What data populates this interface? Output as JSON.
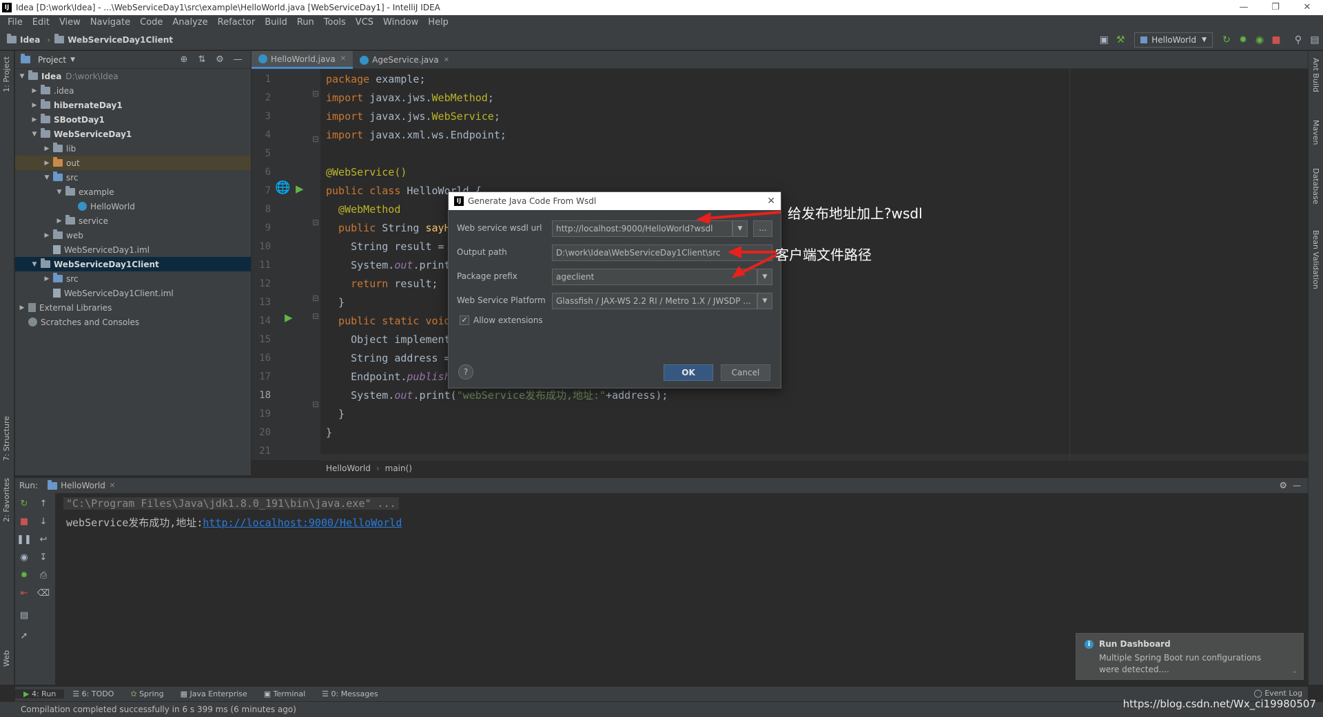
{
  "window": {
    "title": "Idea [D:\\work\\Idea] - ...\\WebServiceDay1\\src\\example\\HelloWorld.java [WebServiceDay1] - IntelliJ IDEA",
    "app_icon": "IJ"
  },
  "menu": [
    "File",
    "Edit",
    "View",
    "Navigate",
    "Code",
    "Analyze",
    "Refactor",
    "Build",
    "Run",
    "Tools",
    "VCS",
    "Window",
    "Help"
  ],
  "navbar": {
    "crumbs": [
      "Idea",
      "WebServiceDay1Client"
    ],
    "run_config": "HelloWorld"
  },
  "left_strip": {
    "project": "1: Project",
    "structure": "7: Structure",
    "favorites": "2: Favorites",
    "web": "Web"
  },
  "right_strip": {
    "ant": "Ant Build",
    "maven": "Maven",
    "database": "Database",
    "bean": "Bean Validation"
  },
  "project": {
    "title": "Project",
    "tree": [
      {
        "label": "Idea",
        "extra": "D:\\work\\Idea",
        "depth": 0,
        "arrow": "down",
        "icon": "folder",
        "bold": true
      },
      {
        "label": ".idea",
        "depth": 1,
        "arrow": "right",
        "icon": "folder"
      },
      {
        "label": "hibernateDay1",
        "depth": 1,
        "arrow": "right",
        "icon": "folder",
        "bold": true
      },
      {
        "label": "SBootDay1",
        "depth": 1,
        "arrow": "right",
        "icon": "folder",
        "bold": true
      },
      {
        "label": "WebServiceDay1",
        "depth": 1,
        "arrow": "down",
        "icon": "folder",
        "bold": true
      },
      {
        "label": "lib",
        "depth": 2,
        "arrow": "right",
        "icon": "folder"
      },
      {
        "label": "out",
        "depth": 2,
        "arrow": "right",
        "icon": "folder-orange",
        "state": "excluded"
      },
      {
        "label": "src",
        "depth": 2,
        "arrow": "down",
        "icon": "folder-blue"
      },
      {
        "label": "example",
        "depth": 3,
        "arrow": "down",
        "icon": "folder"
      },
      {
        "label": "HelloWorld",
        "depth": 4,
        "arrow": "",
        "icon": "class"
      },
      {
        "label": "service",
        "depth": 3,
        "arrow": "right",
        "icon": "folder"
      },
      {
        "label": "web",
        "depth": 2,
        "arrow": "right",
        "icon": "folder"
      },
      {
        "label": "WebServiceDay1.iml",
        "depth": 2,
        "arrow": "",
        "icon": "file"
      },
      {
        "label": "WebServiceDay1Client",
        "depth": 1,
        "arrow": "down",
        "icon": "folder",
        "bold": true,
        "state": "selected"
      },
      {
        "label": "src",
        "depth": 2,
        "arrow": "right",
        "icon": "folder-blue"
      },
      {
        "label": "WebServiceDay1Client.iml",
        "depth": 2,
        "arrow": "",
        "icon": "file"
      },
      {
        "label": "External Libraries",
        "depth": 0,
        "arrow": "right",
        "icon": "lib"
      },
      {
        "label": "Scratches and Consoles",
        "depth": 0,
        "arrow": "",
        "icon": "scratch"
      }
    ]
  },
  "editor": {
    "tabs": [
      {
        "label": "HelloWorld.java",
        "active": true
      },
      {
        "label": "AgeService.java",
        "active": false
      }
    ],
    "lines": [
      [
        {
          "t": "package ",
          "c": "kw"
        },
        {
          "t": "example;",
          "c": "tx"
        }
      ],
      [
        {
          "t": "import ",
          "c": "kw"
        },
        {
          "t": "javax.jws.",
          "c": "tx"
        },
        {
          "t": "WebMethod",
          "c": "an"
        },
        {
          "t": ";",
          "c": "tx"
        }
      ],
      [
        {
          "t": "import ",
          "c": "kw"
        },
        {
          "t": "javax.jws.",
          "c": "tx"
        },
        {
          "t": "WebService",
          "c": "an"
        },
        {
          "t": ";",
          "c": "tx"
        }
      ],
      [
        {
          "t": "import ",
          "c": "kw"
        },
        {
          "t": "javax.xml.ws.Endpoint;",
          "c": "tx"
        }
      ],
      [],
      [
        {
          "t": "@WebService()",
          "c": "an"
        }
      ],
      [
        {
          "t": "public class ",
          "c": "kw"
        },
        {
          "t": "HelloWorld {",
          "c": "tx"
        }
      ],
      [
        {
          "t": "  @WebMethod",
          "c": "an"
        }
      ],
      [
        {
          "t": "  public ",
          "c": "kw"
        },
        {
          "t": "String ",
          "c": "tx"
        },
        {
          "t": "sayH",
          "c": "fn"
        }
      ],
      [
        {
          "t": "    String result = ",
          "c": "tx"
        }
      ],
      [
        {
          "t": "    System.",
          "c": "tx"
        },
        {
          "t": "out",
          "c": "st"
        },
        {
          "t": ".print",
          "c": "tx"
        }
      ],
      [
        {
          "t": "    return ",
          "c": "kw"
        },
        {
          "t": "result;",
          "c": "tx"
        }
      ],
      [
        {
          "t": "  }",
          "c": "tx"
        }
      ],
      [
        {
          "t": "  public static void",
          "c": "kw"
        }
      ],
      [
        {
          "t": "    Object implement",
          "c": "tx"
        }
      ],
      [
        {
          "t": "    String address =",
          "c": "tx"
        }
      ],
      [
        {
          "t": "    Endpoint.",
          "c": "tx"
        },
        {
          "t": "publish",
          "c": "st"
        }
      ],
      [
        {
          "t": "    System.",
          "c": "tx"
        },
        {
          "t": "out",
          "c": "st"
        },
        {
          "t": ".print(",
          "c": "tx"
        },
        {
          "t": "\"webService发布成功,地址:\"",
          "c": "str"
        },
        {
          "t": "+address);",
          "c": "tx"
        }
      ],
      [
        {
          "t": "  }",
          "c": "tx"
        }
      ],
      [
        {
          "t": "}",
          "c": "tx"
        }
      ],
      []
    ],
    "line_numbers": [
      "1",
      "2",
      "3",
      "4",
      "5",
      "6",
      "7",
      "8",
      "9",
      "10",
      "11",
      "12",
      "13",
      "14",
      "15",
      "16",
      "17",
      "18",
      "19",
      "20",
      "21"
    ],
    "breadcrumb": [
      "HelloWorld",
      "main()"
    ]
  },
  "dialog": {
    "title": "Generate Java Code From Wsdl",
    "wsdl_label": "Web service wsdl url",
    "wsdl_value": "http://localhost:9000/HelloWorld?wsdl",
    "browse_label": "...",
    "output_label": "Output path",
    "output_value": "D:\\work\\Idea\\WebServiceDay1Client\\src",
    "package_label": "Package prefix",
    "package_value": "ageclient",
    "platform_label": "Web Service Platform",
    "platform_value": "Glassfish / JAX-WS 2.2 RI / Metro 1.X / JWSDP ...",
    "allow_ext_label": "Allow extensions",
    "allow_ext_checked": true,
    "help_label": "?",
    "ok_label": "OK",
    "cancel_label": "Cancel"
  },
  "annotations": {
    "wsdl_note": "给发布地址加上?wsdl",
    "path_note": "客户端文件路径"
  },
  "run": {
    "label": "Run:",
    "tab": "HelloWorld",
    "console_line1": "\"C:\\Program Files\\Java\\jdk1.8.0_191\\bin\\java.exe\" ...",
    "console_prefix": "webService发布成功,地址:",
    "console_link": "http://localhost:9000/HelloWorld"
  },
  "notification": {
    "title": "Run Dashboard",
    "body": "Multiple Spring Boot run configurations were detected...."
  },
  "bottom_tabs": [
    "4: Run",
    "6: TODO",
    "Spring",
    "Java Enterprise",
    "Terminal",
    "0: Messages"
  ],
  "status": {
    "message": "Compilation completed successfully in 6 s 399 ms (6 minutes ago)",
    "event_log": "Event Log",
    "watermark": "https://blog.csdn.net/Wx_ci19980507"
  },
  "colors": {
    "kw": "#cc7832",
    "tx": "#a9b7c6",
    "an": "#bbb529",
    "fn": "#ffc66d",
    "st": "#9876aa",
    "str": "#6a8759",
    "link": "#287bde",
    "arrow": "#e8211c"
  }
}
